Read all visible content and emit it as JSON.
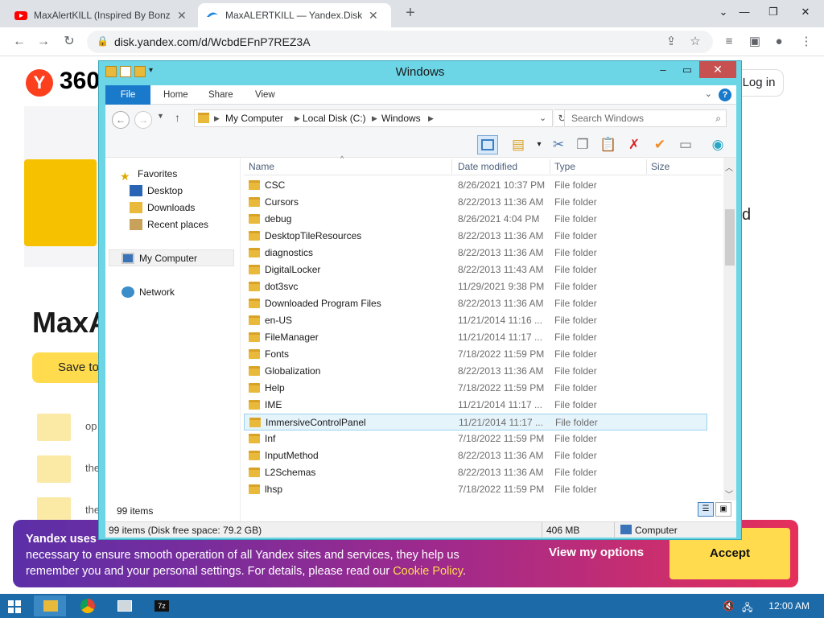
{
  "chrome": {
    "tabs": [
      {
        "title": "MaxAlertKILL (Inspired By BonziK",
        "favicon": "youtube-icon"
      },
      {
        "title": "MaxALERTKILL — Yandex.Disk",
        "favicon": "yandex-disk-icon"
      }
    ],
    "url": "disk.yandex.com/d/WcbdEFnP7REZ3A"
  },
  "page": {
    "logo_text": "Y",
    "brand": "360",
    "login": "Log in",
    "title": "MaxA",
    "right_text": "d",
    "save_btn": "Save to",
    "items": [
      "op",
      "the",
      "the"
    ]
  },
  "cookie": {
    "bold_prefix": "Yandex uses",
    "line1": "necessary to ensure smooth operation of all Yandex sites and services, they help us",
    "line2_prefix": "remember you and your personal settings. For details, please read our",
    "link": "Cookie Policy",
    "period": ".",
    "view_options": "View my options",
    "accept": "Accept"
  },
  "explorer": {
    "window_title": "Windows",
    "ribbon_tabs": [
      "File",
      "Home",
      "Share",
      "View"
    ],
    "help": "?",
    "breadcrumb": [
      "My Computer",
      "Local Disk (C:)",
      "Windows"
    ],
    "search_placeholder": "Search Windows",
    "nav": {
      "favorites": "Favorites",
      "desktop": "Desktop",
      "downloads": "Downloads",
      "recent": "Recent places",
      "my_computer": "My Computer",
      "network": "Network"
    },
    "columns": {
      "name": "Name",
      "date": "Date modified",
      "type": "Type",
      "size": "Size"
    },
    "files": [
      {
        "name": "CSC",
        "date": "8/26/2021 10:37 PM",
        "type": "File folder"
      },
      {
        "name": "Cursors",
        "date": "8/22/2013 11:36 AM",
        "type": "File folder"
      },
      {
        "name": "debug",
        "date": "8/26/2021 4:04 PM",
        "type": "File folder"
      },
      {
        "name": "DesktopTileResources",
        "date": "8/22/2013 11:36 AM",
        "type": "File folder"
      },
      {
        "name": "diagnostics",
        "date": "8/22/2013 11:36 AM",
        "type": "File folder"
      },
      {
        "name": "DigitalLocker",
        "date": "8/22/2013 11:43 AM",
        "type": "File folder"
      },
      {
        "name": "dot3svc",
        "date": "11/29/2021 9:38 PM",
        "type": "File folder"
      },
      {
        "name": "Downloaded Program Files",
        "date": "8/22/2013 11:36 AM",
        "type": "File folder"
      },
      {
        "name": "en-US",
        "date": "11/21/2014 11:16 ...",
        "type": "File folder"
      },
      {
        "name": "FileManager",
        "date": "11/21/2014 11:17 ...",
        "type": "File folder"
      },
      {
        "name": "Fonts",
        "date": "7/18/2022 11:59 PM",
        "type": "File folder"
      },
      {
        "name": "Globalization",
        "date": "8/22/2013 11:36 AM",
        "type": "File folder"
      },
      {
        "name": "Help",
        "date": "7/18/2022 11:59 PM",
        "type": "File folder"
      },
      {
        "name": "IME",
        "date": "11/21/2014 11:17 ...",
        "type": "File folder"
      },
      {
        "name": "ImmersiveControlPanel",
        "date": "11/21/2014 11:17 ...",
        "type": "File folder",
        "selected": true
      },
      {
        "name": "Inf",
        "date": "7/18/2022 11:59 PM",
        "type": "File folder"
      },
      {
        "name": "InputMethod",
        "date": "8/22/2013 11:36 AM",
        "type": "File folder"
      },
      {
        "name": "L2Schemas",
        "date": "8/22/2013 11:36 AM",
        "type": "File folder"
      },
      {
        "name": "lhsp",
        "date": "7/18/2022 11:59 PM",
        "type": "File folder"
      }
    ],
    "item_count": "99 items",
    "status_left": "99 items (Disk free space: 79.2 GB)",
    "status_size": "406 MB",
    "status_location": "Computer"
  },
  "taskbar": {
    "clock": "12:00 AM"
  }
}
